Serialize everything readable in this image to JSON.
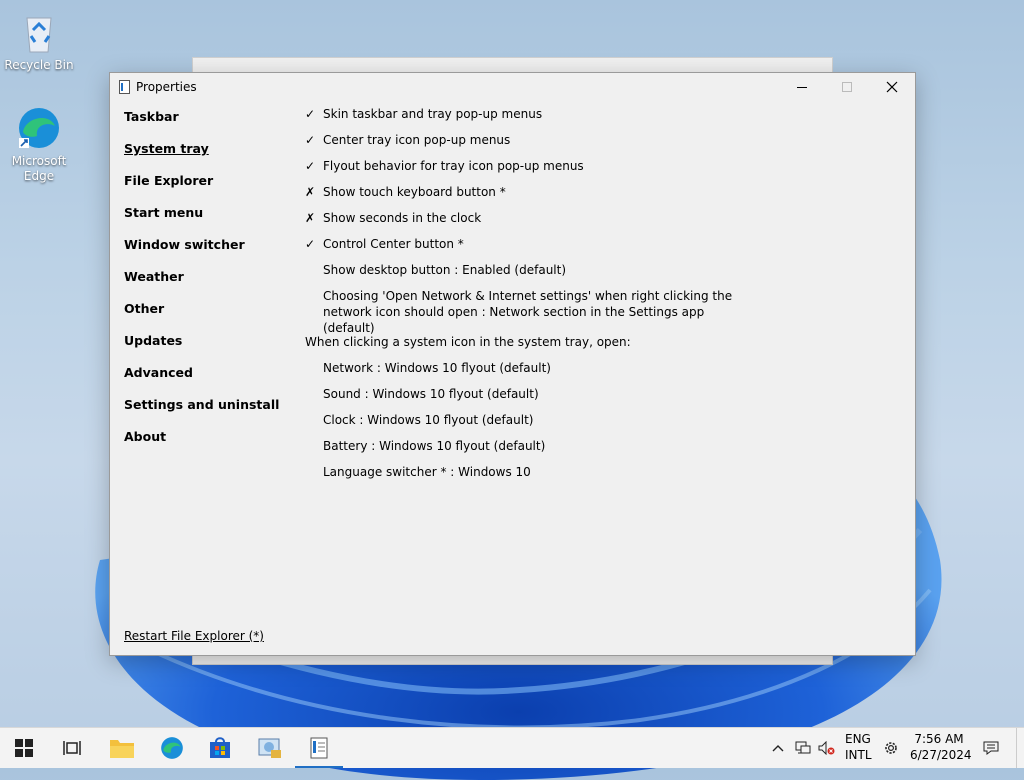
{
  "desktop": {
    "icons": [
      {
        "label": "Recycle Bin",
        "icon": "recycle-bin-icon"
      },
      {
        "label": "Microsoft Edge",
        "icon": "edge-icon"
      }
    ]
  },
  "window": {
    "title": "Properties",
    "controls": {
      "minimize": "minimize-icon",
      "maximize": "maximize-icon",
      "close": "close-icon"
    }
  },
  "nav": {
    "active_index": 1,
    "items": [
      {
        "label": "Taskbar"
      },
      {
        "label": "System tray"
      },
      {
        "label": "File Explorer"
      },
      {
        "label": "Start menu"
      },
      {
        "label": "Window switcher"
      },
      {
        "label": "Weather"
      },
      {
        "label": "Other"
      },
      {
        "label": "Updates"
      },
      {
        "label": "Advanced"
      },
      {
        "label": "Settings and uninstall"
      },
      {
        "label": "About"
      }
    ]
  },
  "options": [
    {
      "mark": "✓",
      "state": "on",
      "label": "Skin taskbar and tray pop-up menus"
    },
    {
      "mark": "✓",
      "state": "on",
      "label": "Center tray icon pop-up menus"
    },
    {
      "mark": "✓",
      "state": "on",
      "label": "Flyout behavior for tray icon pop-up menus"
    },
    {
      "mark": "✗",
      "state": "off",
      "label": "Show touch keyboard button *"
    },
    {
      "mark": "✗",
      "state": "off",
      "label": "Show seconds in the clock"
    },
    {
      "mark": "✓",
      "state": "on",
      "label": "Control Center button *"
    },
    {
      "mark": "",
      "state": "none",
      "label": "Show desktop button : Enabled (default)"
    },
    {
      "mark": "",
      "state": "none",
      "label": "Choosing 'Open Network & Internet settings' when right clicking the network icon should open : Network section in the Settings app (default)"
    }
  ],
  "flyout_section": {
    "heading": "When clicking a system icon in the system tray, open:",
    "items": [
      {
        "label": "Network : Windows 10 flyout (default)"
      },
      {
        "label": "Sound : Windows 10 flyout (default)"
      },
      {
        "label": "Clock : Windows 10 flyout (default)"
      },
      {
        "label": "Battery : Windows 10 flyout (default)"
      },
      {
        "label": "Language switcher * : Windows 10"
      }
    ]
  },
  "footer": {
    "restart_label": "Restart File Explorer (*)"
  },
  "taskbar": {
    "buttons": [
      {
        "name": "start-button",
        "icon": "windows-logo-icon"
      },
      {
        "name": "task-view-button",
        "icon": "task-view-icon"
      },
      {
        "name": "file-explorer-button",
        "icon": "folder-icon"
      },
      {
        "name": "edge-button",
        "icon": "edge-icon"
      },
      {
        "name": "store-button",
        "icon": "store-icon"
      },
      {
        "name": "control-panel-button",
        "icon": "control-panel-icon"
      },
      {
        "name": "properties-app-button",
        "icon": "properties-app-icon",
        "active": true
      }
    ],
    "tray": {
      "lang_line1": "ENG",
      "lang_line2": "INTL",
      "time": "7:56 AM",
      "date": "6/27/2024"
    }
  },
  "colors": {
    "accent": "#1f6fc4",
    "window_bg": "#f0f0f0",
    "taskbar_bg": "#f3f3f3"
  }
}
